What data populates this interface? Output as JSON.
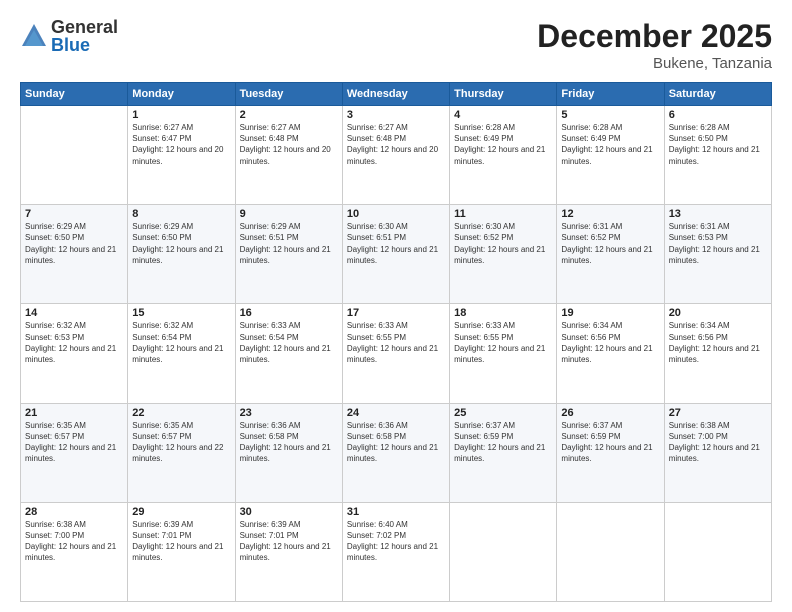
{
  "logo": {
    "general": "General",
    "blue": "Blue"
  },
  "title": "December 2025",
  "location": "Bukene, Tanzania",
  "days_of_week": [
    "Sunday",
    "Monday",
    "Tuesday",
    "Wednesday",
    "Thursday",
    "Friday",
    "Saturday"
  ],
  "weeks": [
    [
      {
        "day": "",
        "sunrise": "",
        "sunset": "",
        "daylight": ""
      },
      {
        "day": "1",
        "sunrise": "Sunrise: 6:27 AM",
        "sunset": "Sunset: 6:47 PM",
        "daylight": "Daylight: 12 hours and 20 minutes."
      },
      {
        "day": "2",
        "sunrise": "Sunrise: 6:27 AM",
        "sunset": "Sunset: 6:48 PM",
        "daylight": "Daylight: 12 hours and 20 minutes."
      },
      {
        "day": "3",
        "sunrise": "Sunrise: 6:27 AM",
        "sunset": "Sunset: 6:48 PM",
        "daylight": "Daylight: 12 hours and 20 minutes."
      },
      {
        "day": "4",
        "sunrise": "Sunrise: 6:28 AM",
        "sunset": "Sunset: 6:49 PM",
        "daylight": "Daylight: 12 hours and 21 minutes."
      },
      {
        "day": "5",
        "sunrise": "Sunrise: 6:28 AM",
        "sunset": "Sunset: 6:49 PM",
        "daylight": "Daylight: 12 hours and 21 minutes."
      },
      {
        "day": "6",
        "sunrise": "Sunrise: 6:28 AM",
        "sunset": "Sunset: 6:50 PM",
        "daylight": "Daylight: 12 hours and 21 minutes."
      }
    ],
    [
      {
        "day": "7",
        "sunrise": "Sunrise: 6:29 AM",
        "sunset": "Sunset: 6:50 PM",
        "daylight": "Daylight: 12 hours and 21 minutes."
      },
      {
        "day": "8",
        "sunrise": "Sunrise: 6:29 AM",
        "sunset": "Sunset: 6:50 PM",
        "daylight": "Daylight: 12 hours and 21 minutes."
      },
      {
        "day": "9",
        "sunrise": "Sunrise: 6:29 AM",
        "sunset": "Sunset: 6:51 PM",
        "daylight": "Daylight: 12 hours and 21 minutes."
      },
      {
        "day": "10",
        "sunrise": "Sunrise: 6:30 AM",
        "sunset": "Sunset: 6:51 PM",
        "daylight": "Daylight: 12 hours and 21 minutes."
      },
      {
        "day": "11",
        "sunrise": "Sunrise: 6:30 AM",
        "sunset": "Sunset: 6:52 PM",
        "daylight": "Daylight: 12 hours and 21 minutes."
      },
      {
        "day": "12",
        "sunrise": "Sunrise: 6:31 AM",
        "sunset": "Sunset: 6:52 PM",
        "daylight": "Daylight: 12 hours and 21 minutes."
      },
      {
        "day": "13",
        "sunrise": "Sunrise: 6:31 AM",
        "sunset": "Sunset: 6:53 PM",
        "daylight": "Daylight: 12 hours and 21 minutes."
      }
    ],
    [
      {
        "day": "14",
        "sunrise": "Sunrise: 6:32 AM",
        "sunset": "Sunset: 6:53 PM",
        "daylight": "Daylight: 12 hours and 21 minutes."
      },
      {
        "day": "15",
        "sunrise": "Sunrise: 6:32 AM",
        "sunset": "Sunset: 6:54 PM",
        "daylight": "Daylight: 12 hours and 21 minutes."
      },
      {
        "day": "16",
        "sunrise": "Sunrise: 6:33 AM",
        "sunset": "Sunset: 6:54 PM",
        "daylight": "Daylight: 12 hours and 21 minutes."
      },
      {
        "day": "17",
        "sunrise": "Sunrise: 6:33 AM",
        "sunset": "Sunset: 6:55 PM",
        "daylight": "Daylight: 12 hours and 21 minutes."
      },
      {
        "day": "18",
        "sunrise": "Sunrise: 6:33 AM",
        "sunset": "Sunset: 6:55 PM",
        "daylight": "Daylight: 12 hours and 21 minutes."
      },
      {
        "day": "19",
        "sunrise": "Sunrise: 6:34 AM",
        "sunset": "Sunset: 6:56 PM",
        "daylight": "Daylight: 12 hours and 21 minutes."
      },
      {
        "day": "20",
        "sunrise": "Sunrise: 6:34 AM",
        "sunset": "Sunset: 6:56 PM",
        "daylight": "Daylight: 12 hours and 21 minutes."
      }
    ],
    [
      {
        "day": "21",
        "sunrise": "Sunrise: 6:35 AM",
        "sunset": "Sunset: 6:57 PM",
        "daylight": "Daylight: 12 hours and 21 minutes."
      },
      {
        "day": "22",
        "sunrise": "Sunrise: 6:35 AM",
        "sunset": "Sunset: 6:57 PM",
        "daylight": "Daylight: 12 hours and 22 minutes."
      },
      {
        "day": "23",
        "sunrise": "Sunrise: 6:36 AM",
        "sunset": "Sunset: 6:58 PM",
        "daylight": "Daylight: 12 hours and 21 minutes."
      },
      {
        "day": "24",
        "sunrise": "Sunrise: 6:36 AM",
        "sunset": "Sunset: 6:58 PM",
        "daylight": "Daylight: 12 hours and 21 minutes."
      },
      {
        "day": "25",
        "sunrise": "Sunrise: 6:37 AM",
        "sunset": "Sunset: 6:59 PM",
        "daylight": "Daylight: 12 hours and 21 minutes."
      },
      {
        "day": "26",
        "sunrise": "Sunrise: 6:37 AM",
        "sunset": "Sunset: 6:59 PM",
        "daylight": "Daylight: 12 hours and 21 minutes."
      },
      {
        "day": "27",
        "sunrise": "Sunrise: 6:38 AM",
        "sunset": "Sunset: 7:00 PM",
        "daylight": "Daylight: 12 hours and 21 minutes."
      }
    ],
    [
      {
        "day": "28",
        "sunrise": "Sunrise: 6:38 AM",
        "sunset": "Sunset: 7:00 PM",
        "daylight": "Daylight: 12 hours and 21 minutes."
      },
      {
        "day": "29",
        "sunrise": "Sunrise: 6:39 AM",
        "sunset": "Sunset: 7:01 PM",
        "daylight": "Daylight: 12 hours and 21 minutes."
      },
      {
        "day": "30",
        "sunrise": "Sunrise: 6:39 AM",
        "sunset": "Sunset: 7:01 PM",
        "daylight": "Daylight: 12 hours and 21 minutes."
      },
      {
        "day": "31",
        "sunrise": "Sunrise: 6:40 AM",
        "sunset": "Sunset: 7:02 PM",
        "daylight": "Daylight: 12 hours and 21 minutes."
      },
      {
        "day": "",
        "sunrise": "",
        "sunset": "",
        "daylight": ""
      },
      {
        "day": "",
        "sunrise": "",
        "sunset": "",
        "daylight": ""
      },
      {
        "day": "",
        "sunrise": "",
        "sunset": "",
        "daylight": ""
      }
    ]
  ]
}
